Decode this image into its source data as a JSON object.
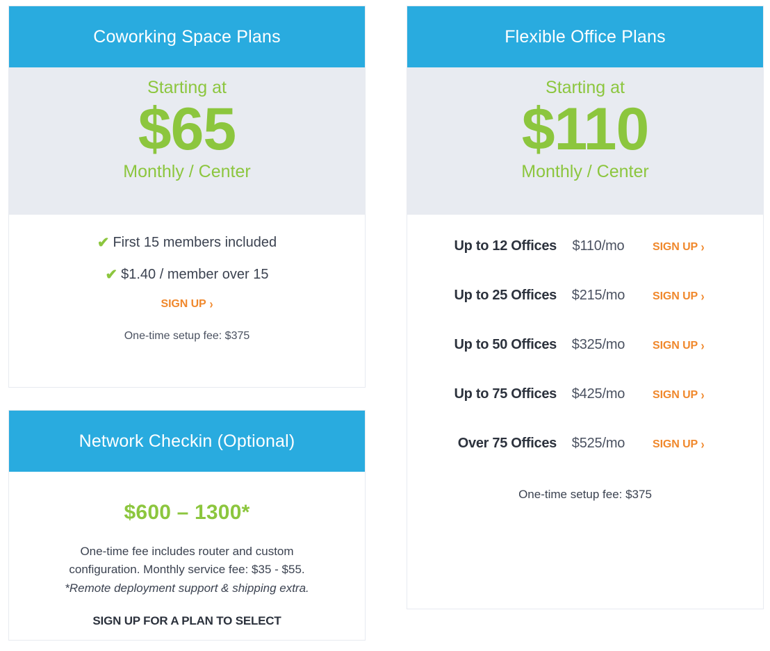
{
  "colors": {
    "header_blue": "#29abdf",
    "price_green": "#8cc63e",
    "cta_orange": "#f0882c",
    "panel_gray": "#e8ebf1",
    "text_dark": "#2c323d",
    "card_border": "#e7eaf0"
  },
  "coworking_card": {
    "title": "Coworking Space Plans",
    "starting_at": "Starting at",
    "price": "$65",
    "period": "Monthly / Center",
    "features": [
      {
        "icon": "check-icon",
        "text": "First 15 members included"
      },
      {
        "icon": "check-icon",
        "text": "$1.40 / member over 15"
      }
    ],
    "signup_label": "SIGN UP",
    "signup_chevron": "›",
    "setup_fee": "One-time setup fee: $375"
  },
  "network_checkin_card": {
    "title": "Network Checkin (Optional)",
    "price_range": "$600 – 1300*",
    "description_line1": "One-time fee includes router and custom",
    "description_line2": "configuration. Monthly service fee: $35 - $55.",
    "footnote": "*Remote deployment support & shipping extra.",
    "cta": "SIGN UP FOR A PLAN TO SELECT"
  },
  "flexible_office_card": {
    "title": "Flexible Office Plans",
    "starting_at": "Starting at",
    "price": "$110",
    "period": "Monthly / Center",
    "signup_label": "SIGN UP",
    "signup_chevron": "›",
    "rows": [
      {
        "label": "Up to 12 Offices",
        "price": "$110/mo",
        "cta": "SIGN UP"
      },
      {
        "label": "Up to 25 Offices",
        "price": "$215/mo",
        "cta": "SIGN UP"
      },
      {
        "label": "Up to 50 Offices",
        "price": "$325/mo",
        "cta": "SIGN UP"
      },
      {
        "label": "Up to 75 Offices",
        "price": "$425/mo",
        "cta": "SIGN UP"
      },
      {
        "label": "Over 75 Offices",
        "price": "$525/mo",
        "cta": "SIGN UP"
      }
    ],
    "setup_fee": "One-time setup fee: $375"
  }
}
